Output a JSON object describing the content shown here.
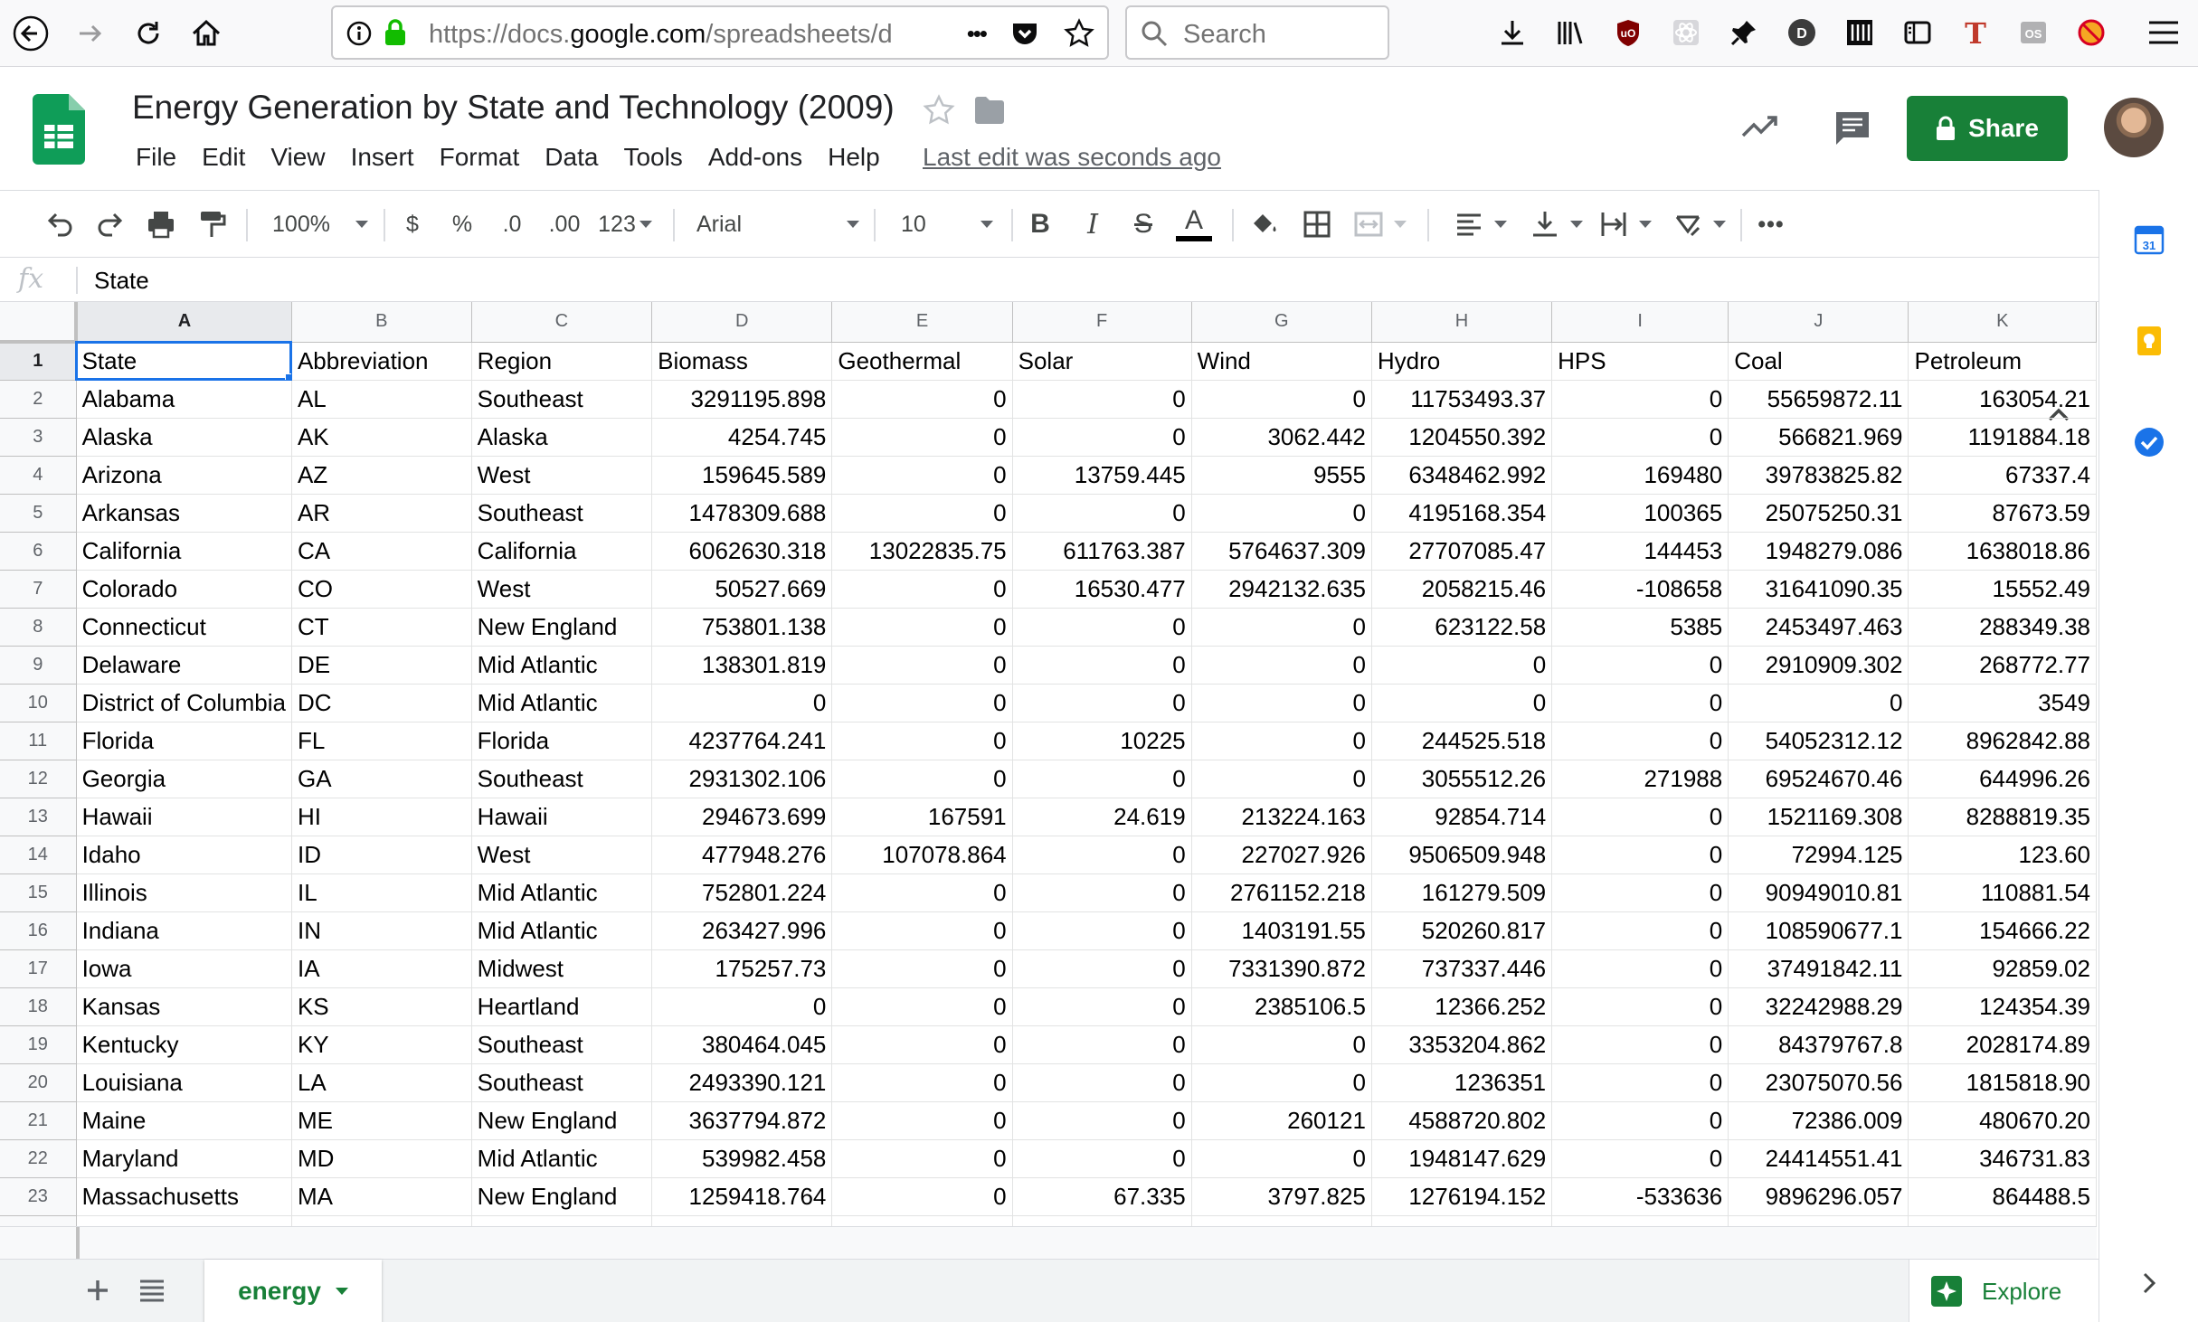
{
  "browser": {
    "url_prefix": "https://docs.",
    "url_domain": "google.com",
    "url_rest": "/spreadsheets/d",
    "search_placeholder": "Search",
    "more_label": "•••"
  },
  "doc": {
    "title": "Energy Generation by State and Technology (2009)",
    "last_edit": "Last edit was seconds ago",
    "share_label": "Share",
    "menus": [
      "File",
      "Edit",
      "View",
      "Insert",
      "Format",
      "Data",
      "Tools",
      "Add-ons",
      "Help"
    ]
  },
  "toolbar": {
    "zoom": "100%",
    "currency": "$",
    "percent": "%",
    "decrease_decimal": ".0",
    "increase_decimal": ".00",
    "more_formats": "123",
    "font": "Arial",
    "font_size": "10",
    "bold": "B",
    "italic": "I",
    "strike": "S",
    "text_color": "A",
    "more": "•••"
  },
  "formula_bar": {
    "fx": "fx",
    "content": "State"
  },
  "grid": {
    "columns": [
      "A",
      "B",
      "C",
      "D",
      "E",
      "F",
      "G",
      "H",
      "I",
      "J",
      "K"
    ],
    "column_align": [
      "left",
      "left",
      "left",
      "right",
      "right",
      "right",
      "right",
      "right",
      "right",
      "right",
      "right"
    ],
    "active_cell": "A1",
    "rows": [
      {
        "n": "1",
        "cells": [
          "State",
          "Abbreviation",
          "Region",
          "Biomass",
          "Geothermal",
          "Solar",
          "Wind",
          "Hydro",
          "HPS",
          "Coal",
          "Petroleum"
        ]
      },
      {
        "n": "2",
        "cells": [
          "Alabama",
          "AL",
          "Southeast",
          "3291195.898",
          "0",
          "0",
          "0",
          "11753493.37",
          "0",
          "55659872.11",
          "163054.21"
        ]
      },
      {
        "n": "3",
        "cells": [
          "Alaska",
          "AK",
          "Alaska",
          "4254.745",
          "0",
          "0",
          "3062.442",
          "1204550.392",
          "0",
          "566821.969",
          "1191884.18"
        ]
      },
      {
        "n": "4",
        "cells": [
          "Arizona",
          "AZ",
          "West",
          "159645.589",
          "0",
          "13759.445",
          "9555",
          "6348462.992",
          "169480",
          "39783825.82",
          "67337.4"
        ]
      },
      {
        "n": "5",
        "cells": [
          "Arkansas",
          "AR",
          "Southeast",
          "1478309.688",
          "0",
          "0",
          "0",
          "4195168.354",
          "100365",
          "25075250.31",
          "87673.59"
        ]
      },
      {
        "n": "6",
        "cells": [
          "California",
          "CA",
          "California",
          "6062630.318",
          "13022835.75",
          "611763.387",
          "5764637.309",
          "27707085.47",
          "144453",
          "1948279.086",
          "1638018.86"
        ]
      },
      {
        "n": "7",
        "cells": [
          "Colorado",
          "CO",
          "West",
          "50527.669",
          "0",
          "16530.477",
          "2942132.635",
          "2058215.46",
          "-108658",
          "31641090.35",
          "15552.49"
        ]
      },
      {
        "n": "8",
        "cells": [
          "Connecticut",
          "CT",
          "New England",
          "753801.138",
          "0",
          "0",
          "0",
          "623122.58",
          "5385",
          "2453497.463",
          "288349.38"
        ]
      },
      {
        "n": "9",
        "cells": [
          "Delaware",
          "DE",
          "Mid Atlantic",
          "138301.819",
          "0",
          "0",
          "0",
          "0",
          "0",
          "2910909.302",
          "268772.77"
        ]
      },
      {
        "n": "10",
        "cells": [
          "District of Columbia",
          "DC",
          "Mid Atlantic",
          "0",
          "0",
          "0",
          "0",
          "0",
          "0",
          "0",
          "3549"
        ]
      },
      {
        "n": "11",
        "cells": [
          "Florida",
          "FL",
          "Florida",
          "4237764.241",
          "0",
          "10225",
          "0",
          "244525.518",
          "0",
          "54052312.12",
          "8962842.88"
        ]
      },
      {
        "n": "12",
        "cells": [
          "Georgia",
          "GA",
          "Southeast",
          "2931302.106",
          "0",
          "0",
          "0",
          "3055512.26",
          "271988",
          "69524670.46",
          "644996.26"
        ]
      },
      {
        "n": "13",
        "cells": [
          "Hawaii",
          "HI",
          "Hawaii",
          "294673.699",
          "167591",
          "24.619",
          "213224.163",
          "92854.714",
          "0",
          "1521169.308",
          "8288819.35"
        ]
      },
      {
        "n": "14",
        "cells": [
          "Idaho",
          "ID",
          "West",
          "477948.276",
          "107078.864",
          "0",
          "227027.926",
          "9506509.948",
          "0",
          "72994.125",
          "123.60"
        ]
      },
      {
        "n": "15",
        "cells": [
          "Illinois",
          "IL",
          "Mid Atlantic",
          "752801.224",
          "0",
          "0",
          "2761152.218",
          "161279.509",
          "0",
          "90949010.81",
          "110881.54"
        ]
      },
      {
        "n": "16",
        "cells": [
          "Indiana",
          "IN",
          "Mid Atlantic",
          "263427.996",
          "0",
          "0",
          "1403191.55",
          "520260.817",
          "0",
          "108590677.1",
          "154666.22"
        ]
      },
      {
        "n": "17",
        "cells": [
          "Iowa",
          "IA",
          "Midwest",
          "175257.73",
          "0",
          "0",
          "7331390.872",
          "737337.446",
          "0",
          "37491842.11",
          "92859.02"
        ]
      },
      {
        "n": "18",
        "cells": [
          "Kansas",
          "KS",
          "Heartland",
          "0",
          "0",
          "0",
          "2385106.5",
          "12366.252",
          "0",
          "32242988.29",
          "124354.39"
        ]
      },
      {
        "n": "19",
        "cells": [
          "Kentucky",
          "KY",
          "Southeast",
          "380464.045",
          "0",
          "0",
          "0",
          "3353204.862",
          "0",
          "84379767.8",
          "2028174.89"
        ]
      },
      {
        "n": "20",
        "cells": [
          "Louisiana",
          "LA",
          "Southeast",
          "2493390.121",
          "0",
          "0",
          "0",
          "1236351",
          "0",
          "23075070.56",
          "1815818.90"
        ]
      },
      {
        "n": "21",
        "cells": [
          "Maine",
          "ME",
          "New England",
          "3637794.872",
          "0",
          "0",
          "260121",
          "4588720.802",
          "0",
          "72386.009",
          "480670.20"
        ]
      },
      {
        "n": "22",
        "cells": [
          "Maryland",
          "MD",
          "Mid Atlantic",
          "539982.458",
          "0",
          "0",
          "0",
          "1948147.629",
          "0",
          "24414551.41",
          "346731.83"
        ]
      },
      {
        "n": "23",
        "cells": [
          "Massachusetts",
          "MA",
          "New England",
          "1259418.764",
          "0",
          "67.335",
          "3797.825",
          "1276194.152",
          "-533636",
          "9896296.057",
          "864488.5"
        ]
      }
    ]
  },
  "sheet_tabs": {
    "active": "energy",
    "explore_label": "Explore"
  },
  "side_panel": {
    "calendar_label": "31"
  },
  "colors": {
    "accent_green": "#188038",
    "selection_blue": "#1a73e8"
  }
}
